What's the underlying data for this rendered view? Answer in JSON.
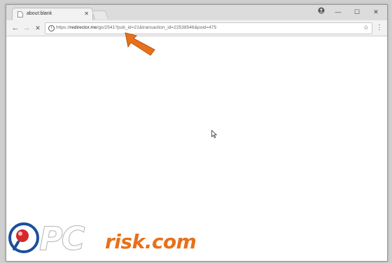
{
  "browser": {
    "tab": {
      "title": "about:blank",
      "close_glyph": "✕",
      "favicon": "page-icon"
    },
    "window_controls": {
      "account_icon": "account-icon",
      "minimize_glyph": "—",
      "maximize_glyph": "☐",
      "close_glyph": "✕"
    },
    "nav": {
      "back_glyph": "←",
      "forward_glyph": "→",
      "stop_glyph": "✕"
    },
    "omnibox": {
      "info_glyph": "i",
      "url_prefix": "https://",
      "url_host": "redirector.me",
      "url_path": "/go/2541?pub_id=21&transaction_id=22538546&poid=475",
      "bookmark_glyph": "☆"
    },
    "menu_glyph": "⋮"
  },
  "watermark": {
    "brand_pc": "PC",
    "brand_rest": "risk.com"
  },
  "colors": {
    "arrow": "#e8701a",
    "brand_orange": "#e8701a",
    "logo_blue": "#1a4f9c",
    "logo_red": "#d6272a"
  }
}
